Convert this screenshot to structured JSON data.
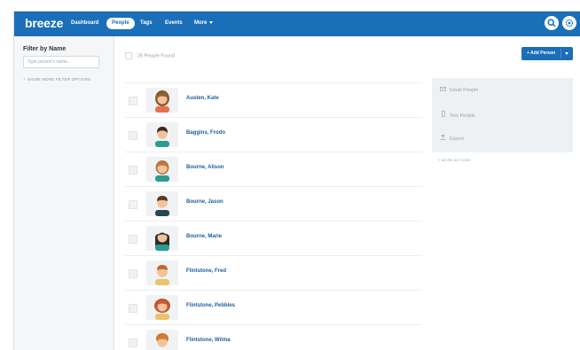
{
  "app": {
    "logo": "breeze",
    "nav": [
      {
        "label": "Dashboard"
      },
      {
        "label": "People"
      },
      {
        "label": "Tags"
      },
      {
        "label": "Events"
      },
      {
        "label": "More"
      }
    ],
    "active_nav": "People",
    "accent_color": "#1b6fb8"
  },
  "sidebar": {
    "filter_title": "Filter by Name",
    "filter_placeholder": "Type person's name...",
    "more_filters": "SHOW MORE FILTER OPTIONS"
  },
  "results": {
    "count_text": "25 People Found"
  },
  "people": [
    {
      "name": "Austen, Kate",
      "avatar": "female-avatar"
    },
    {
      "name": "Baggins, Frodo",
      "avatar": "male-avatar"
    },
    {
      "name": "Bourne, Alison",
      "avatar": "female-avatar"
    },
    {
      "name": "Bourne, Jason",
      "avatar": "male-avatar"
    },
    {
      "name": "Bourne, Marie",
      "avatar": "female-avatar"
    },
    {
      "name": "Flintstone, Fred",
      "avatar": "male-avatar"
    },
    {
      "name": "Flintstone, Pebbles",
      "avatar": "female-avatar"
    },
    {
      "name": "Flintstone, Wilma",
      "avatar": "female-avatar"
    }
  ],
  "add_button": {
    "label": "+ Add Person"
  },
  "actions": {
    "items": [
      {
        "label": "Email People",
        "icon": "envelope-icon"
      },
      {
        "label": "Text People",
        "icon": "phone-icon"
      },
      {
        "label": "Export",
        "icon": "export-icon"
      }
    ],
    "more": "MORE ACTIONS"
  }
}
